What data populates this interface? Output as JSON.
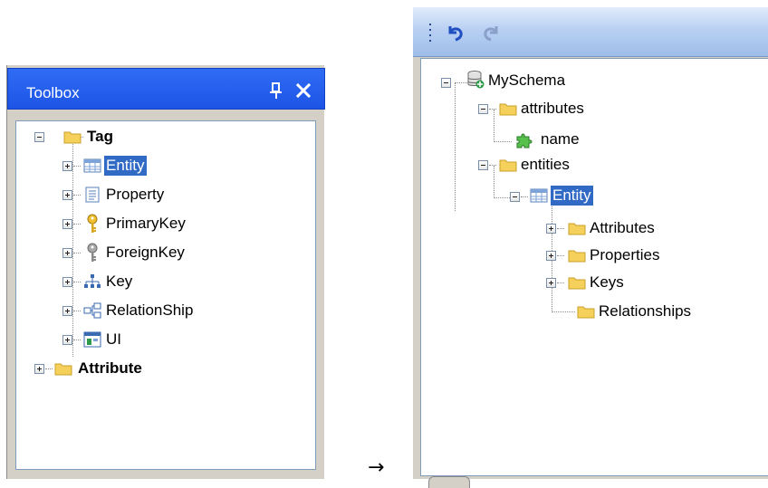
{
  "toolbox": {
    "title": "Toolbox",
    "tree": {
      "root_tag": "Tag",
      "items": [
        "Entity",
        "Property",
        "PrimaryKey",
        "ForeignKey",
        "Key",
        "RelationShip",
        "UI"
      ],
      "root_attribute": "Attribute"
    }
  },
  "arrow": "→",
  "designer": {
    "tree": {
      "schema": "MySchema",
      "attributes_folder": "attributes",
      "attribute_name": "name",
      "entities_folder": "entities",
      "entity": "Entity",
      "entity_children": [
        "Attributes",
        "Properties",
        "Keys",
        "Relationships"
      ]
    }
  },
  "colors": {
    "titlebar": "#2460ee",
    "selection": "#316ac5",
    "folder": "#f5d05a",
    "panel": "#d4d0c8"
  }
}
